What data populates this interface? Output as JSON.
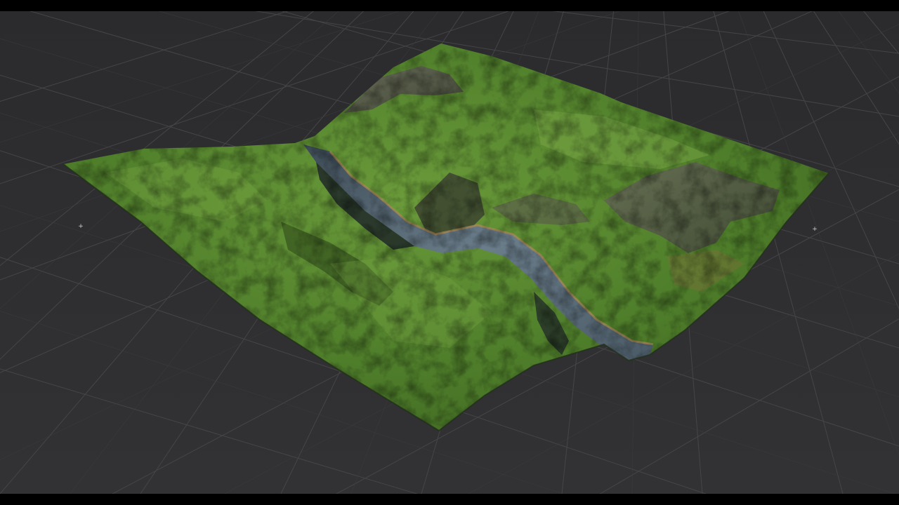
{
  "app": {
    "accent": "#5b8c2e",
    "background": "#2f2f31",
    "grid_color": "#4a4a4d"
  },
  "viewport": {
    "content": "terrain-mesh",
    "water_color": "#5a6e7c",
    "grass_color": "#4e7d2a",
    "rock_color": "#5c5a55"
  },
  "icons": {
    "left_marker": "crosshair",
    "right_marker": "crosshair"
  }
}
